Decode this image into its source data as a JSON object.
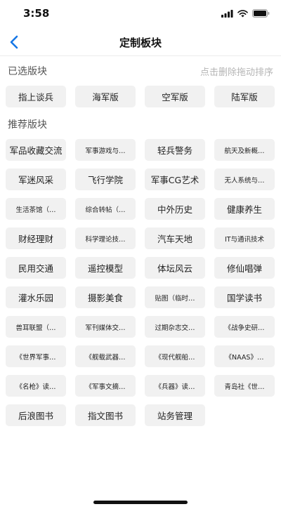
{
  "status": {
    "time": "3:58"
  },
  "nav": {
    "title": "定制板块"
  },
  "selected": {
    "title": "已选版块",
    "hint": "点击删除拖动排序",
    "items": [
      "指上谈兵",
      "海军版",
      "空军版",
      "陆军版"
    ]
  },
  "recommended": {
    "title": "推荐版块",
    "items": [
      "军品收藏交流",
      "军事游戏与…",
      "轻兵警务",
      "航天及新概…",
      "军迷风采",
      "飞行学院",
      "军事CG艺术",
      "无人系统与…",
      "生活茶馆（…",
      "综合转帖（…",
      "中外历史",
      "健康养生",
      "财经理财",
      "科学理论技…",
      "汽车天地",
      "IT与通讯技术",
      "民用交通",
      "遥控模型",
      "体坛风云",
      "修仙唱弹",
      "灌水乐园",
      "摄影美食",
      "贴图（临时…",
      "国学读书",
      "兽耳联盟（…",
      "军刊媒体交…",
      "过期杂志交…",
      "《战争史研…",
      "《世界军事…",
      "《舰载武器…",
      "《现代舰船…",
      "《NAAS》…",
      "《名枪》读…",
      "《军事文摘…",
      "《兵器》读…",
      "青岛社《世…",
      "后浪图书",
      "指文图书",
      "站务管理"
    ],
    "small_items": [
      1,
      3,
      7,
      8,
      9,
      13,
      15,
      22,
      24,
      25,
      26,
      27,
      28,
      29,
      30,
      31,
      32,
      33,
      34,
      35
    ]
  },
  "colors": {
    "accent": "#1677e6",
    "chip_bg": "#f1f1f1"
  },
  "icons": {
    "back": "chevron-left-icon",
    "signal": "signal-icon",
    "wifi": "wifi-icon",
    "battery": "battery-icon"
  }
}
